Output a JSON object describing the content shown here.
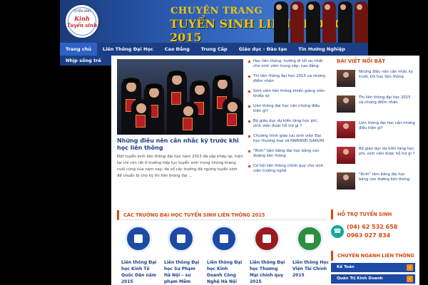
{
  "header": {
    "logo_line1": "Kinh",
    "logo_line2": "Tuyển sinh",
    "logo_arc": "TUYỂN SINH",
    "title_small": "CHUYÊN TRANG",
    "title_big": "TUYỂN SINH LIÊN THÔNG 2015"
  },
  "nav": {
    "items": [
      {
        "label": "Trang chủ"
      },
      {
        "label": "Liên Thông Đại Học"
      },
      {
        "label": "Cao Đẳng"
      },
      {
        "label": "Trung Cấp"
      },
      {
        "label": "Giáo dục - Đào tạo"
      },
      {
        "label": "Tin Hướng Nghiệp"
      }
    ],
    "item2": "Nhịp sống trẻ"
  },
  "feature": {
    "title": "Những điều nên cân nhắc kỹ trước khi học liên thông",
    "excerpt": "Đợt tuyển sinh liên thông đại học năm 2015 đã sắp khép lại, hiện tại chỉ còn rất ít trường tiếp tục tuyển sinh trong những tháng cuối cùng của năm nay; đa số các trường đã ngừng tuyển sinh để chuẩn bị cho kỳ thi liên thông đại ..."
  },
  "news": [
    {
      "text": "Học liên thông- hướng đi tối ưu nhất cho sinh viên trung cấp, cao đẳng"
    },
    {
      "text": "Thi liên thông đại học 2015 và những điểm nhấn"
    },
    {
      "text": "Sinh viên liên thông khiến giảng viên khiếp sợ"
    },
    {
      "text": "Liên thông đại học cần những điều kiện gì?"
    },
    {
      "text": "Bộ giáo dục dự kiến tăng học phí, sinh viên được hỗ trợ gì ?"
    },
    {
      "text": "Chương trình giao lưu sinh viên Đại học thương mại và KWANSEI GAKUIN"
    },
    {
      "text": "\"Rinh\" tấm bằng đại học bằng con đường liên thông"
    },
    {
      "text": "Cơ hội liên thông chính quy cho sinh viên trường nghề"
    }
  ],
  "featured": {
    "heading": "BÀI VIẾT NỔI BẬT",
    "items": [
      {
        "text": "Những điều nên cân nhắc kỹ trước khi học liên thông"
      },
      {
        "text": "Thi liên thông đại học 2015 và những điểm nhấn"
      },
      {
        "text": "Liên thông đại học cần những điều kiện gì?"
      },
      {
        "text": "Bộ giáo dục dự kiến tăng học phí, sinh viên được hỗ trợ gì ?"
      },
      {
        "text": "\"Rinh\" tấm bằng đại học bằng con đường liên thông"
      }
    ]
  },
  "schools": {
    "heading": "CÁC TRƯỜNG ĐẠI HỌC TUYỂN SINH LIÊN THÔNG 2015",
    "items": [
      {
        "name": "Liên thông Đại học Kinh Tế Quốc Dân năm 2015"
      },
      {
        "name": "Liên thông Đại học Sư Phạm Hà Nội – sư phạm Mầm"
      },
      {
        "name": "Liên thông Đại học Kinh Doanh Công Nghệ Hà Nội"
      },
      {
        "name": "Liên thông Đại học Thương Mại chính quy 2015"
      },
      {
        "name": "Liên thông Học Viện Tài Chính 2015"
      }
    ]
  },
  "support": {
    "heading": "HỖ TRỢ TUYỂN SINH",
    "phone1": "(04) 62 532 658",
    "phone2": "0963 027 834"
  },
  "majors": {
    "heading": "CHUYÊN NGÀNH LIÊN THÔNG",
    "items": [
      {
        "label": "Kế Toán"
      },
      {
        "label": "Quản Trị Kinh Doanh"
      }
    ]
  }
}
